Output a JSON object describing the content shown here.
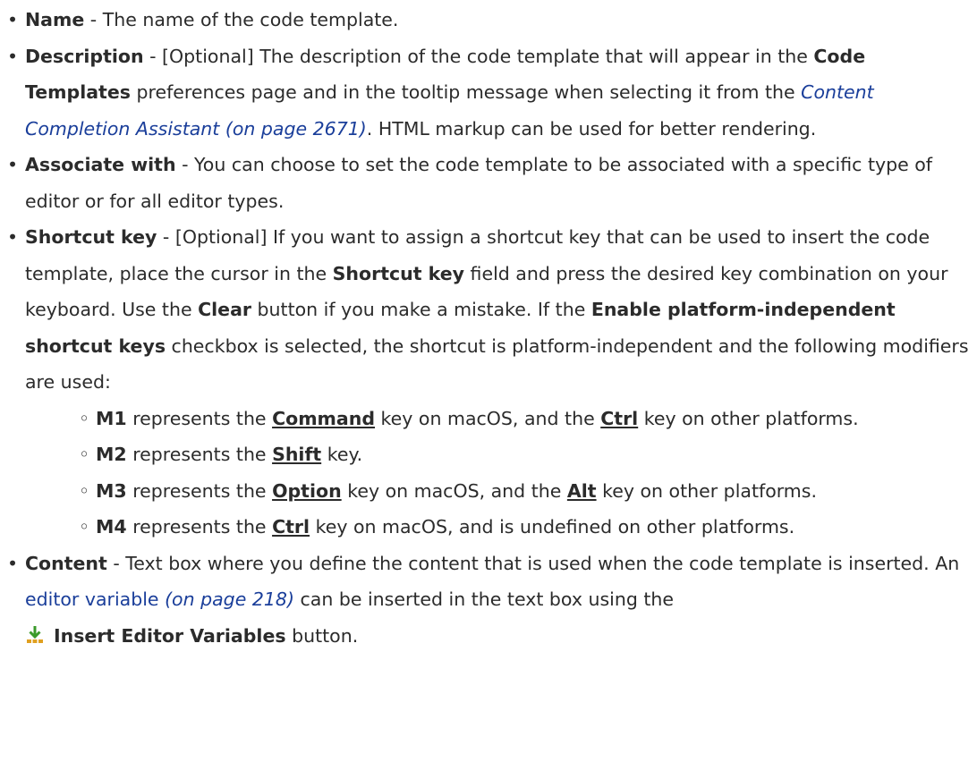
{
  "items": {
    "name": {
      "term": "Name",
      "text": " - The name of the code template."
    },
    "description": {
      "term": "Description",
      "t1": " - [Optional] The description of the code template that will appear in the ",
      "b1": "Code Templates",
      "t2": " preferences page and in the tooltip message when selecting it from the ",
      "link": "Content Completion Assistant (on page 2671)",
      "t3": ". HTML markup can be used for better rendering."
    },
    "associate": {
      "term": "Associate with",
      "text": " - You can choose to set the code template to be associated with a specific type of editor or for all editor types."
    },
    "shortcut": {
      "term": "Shortcut key",
      "t1": " - [Optional] If you want to assign a shortcut key that can be used to insert the code template, place the cursor in the ",
      "b1": "Shortcut key",
      "t2": " field and press the desired key combination on your keyboard. Use the ",
      "b2": "Clear",
      "t3": " button if you make a mistake. If the ",
      "b3": "Enable platform-independent shortcut keys",
      "t4": " checkbox is selected, the shortcut is platform-independent and the following modifiers are used:",
      "modifiers": [
        {
          "key": "M1",
          "t1": " represents the ",
          "k1": "Command",
          "t2": " key on macOS, and the ",
          "k2": "Ctrl",
          "t3": " key on other platforms."
        },
        {
          "key": "M2",
          "t1": " represents the ",
          "k1": "Shift",
          "t2": " key."
        },
        {
          "key": "M3",
          "t1": " represents the ",
          "k1": "Option",
          "t2": " key on macOS, and the ",
          "k2": "Alt",
          "t3": " key on other platforms."
        },
        {
          "key": "M4",
          "t1": " represents the ",
          "k1": "Ctrl",
          "t2": " key on macOS, and is undefined on other platforms."
        }
      ]
    },
    "content": {
      "term": "Content",
      "t1": " - Text box where you define the content that is used when the code template is inserted. An ",
      "link_text": "editor variable",
      "link_page": " (on page 218)",
      "t2": " can be inserted in the text box using the",
      "button_label": "Insert Editor Variables",
      "t3": " button."
    }
  },
  "colors": {
    "text": "#2b2b2b",
    "link": "#1a3e9a",
    "icon_arrow": "#3a9a2a",
    "icon_base": "#e0a020"
  },
  "icons": {
    "insert_editor_variables": "insert-editor-variables-icon"
  }
}
